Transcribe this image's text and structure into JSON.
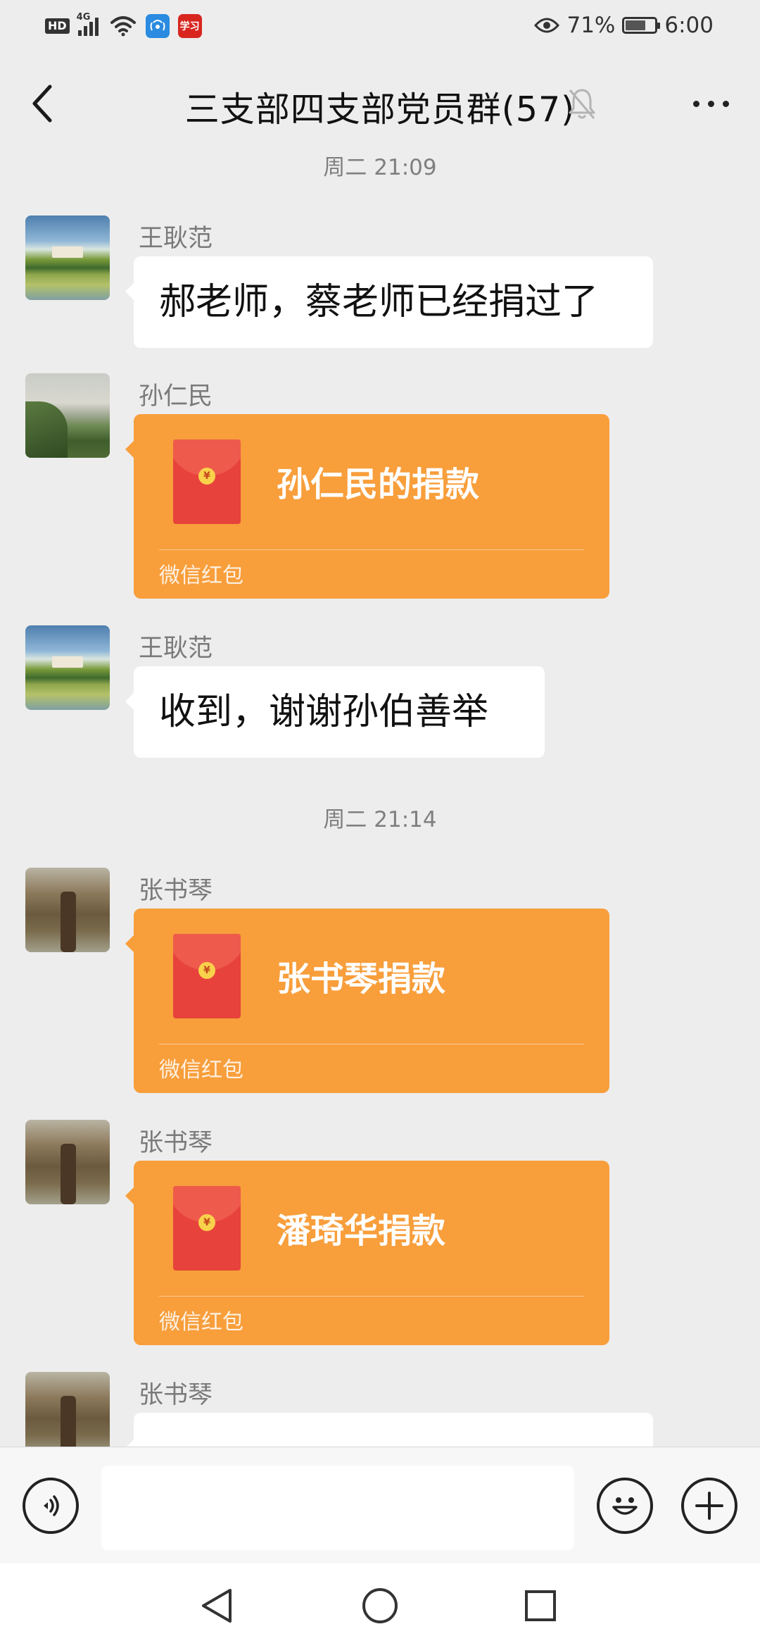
{
  "status_bar": {
    "hd": "HD",
    "network": "4G",
    "battery": "71%",
    "battery_level": 0.71,
    "time": "6:00",
    "app_badge": "学习"
  },
  "header": {
    "title": "三支部四支部党员群(57)",
    "icons": [
      "back-icon",
      "mute-bell-icon",
      "more-icon"
    ]
  },
  "messages": {
    "timestamp_1": "周二 21:09",
    "m1": {
      "sender": "王耿范",
      "text": "郝老师，蔡老师已经捐过了"
    },
    "m2": {
      "sender": "孙仁民",
      "title": "孙仁民的捐款",
      "footer": "微信红包"
    },
    "m3": {
      "sender": "王耿范",
      "text": "收到，谢谢孙伯善举"
    },
    "timestamp_2": "周二 21:14",
    "m4": {
      "sender": "张书琴",
      "title": "张书琴捐款",
      "footer": "微信红包"
    },
    "m5": {
      "sender": "张书琴",
      "title": "潘琦华捐款",
      "footer": "微信红包"
    },
    "m6": {
      "sender": "张书琴",
      "text": ""
    }
  },
  "input_bar": {
    "value": "",
    "icons": [
      "voice-icon",
      "emoji-icon",
      "plus-icon"
    ]
  },
  "nav_bar": {
    "icons": [
      "nav-back-icon",
      "nav-home-icon",
      "nav-recents-icon"
    ]
  },
  "colors": {
    "background": "#ededed",
    "red_packet": "#f89e3b",
    "envelope": "#e7423b",
    "bubble": "#ffffff"
  }
}
